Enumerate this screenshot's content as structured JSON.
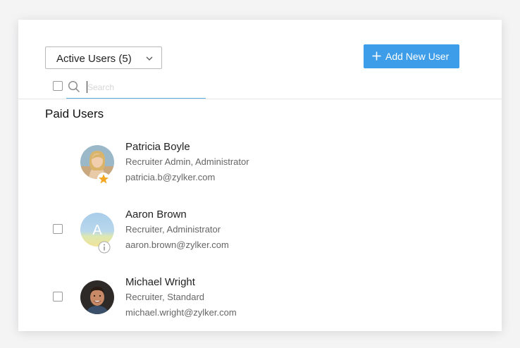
{
  "header": {
    "filter_label": "Active Users (5)",
    "add_button_label": "Add New User"
  },
  "search": {
    "placeholder": "Search",
    "value": ""
  },
  "section": {
    "title": "Paid Users"
  },
  "users": [
    {
      "name": "Patricia Boyle",
      "role": "Recruiter Admin, Administrator",
      "email": "patricia.b@zylker.com",
      "badge_icon": "star-icon",
      "has_checkbox": false
    },
    {
      "name": "Aaron Brown",
      "role": "Recruiter, Administrator",
      "email": "aaron.brown@zylker.com",
      "avatar_initial": "A",
      "badge_icon": "info-icon",
      "has_checkbox": true
    },
    {
      "name": "Michael Wright",
      "role": "Recruiter, Standard",
      "email": "michael.wright@zylker.com",
      "has_checkbox": true
    }
  ],
  "colors": {
    "accent": "#3d9de8",
    "star": "#f5a623",
    "search_underline": "#5ab2e4"
  }
}
